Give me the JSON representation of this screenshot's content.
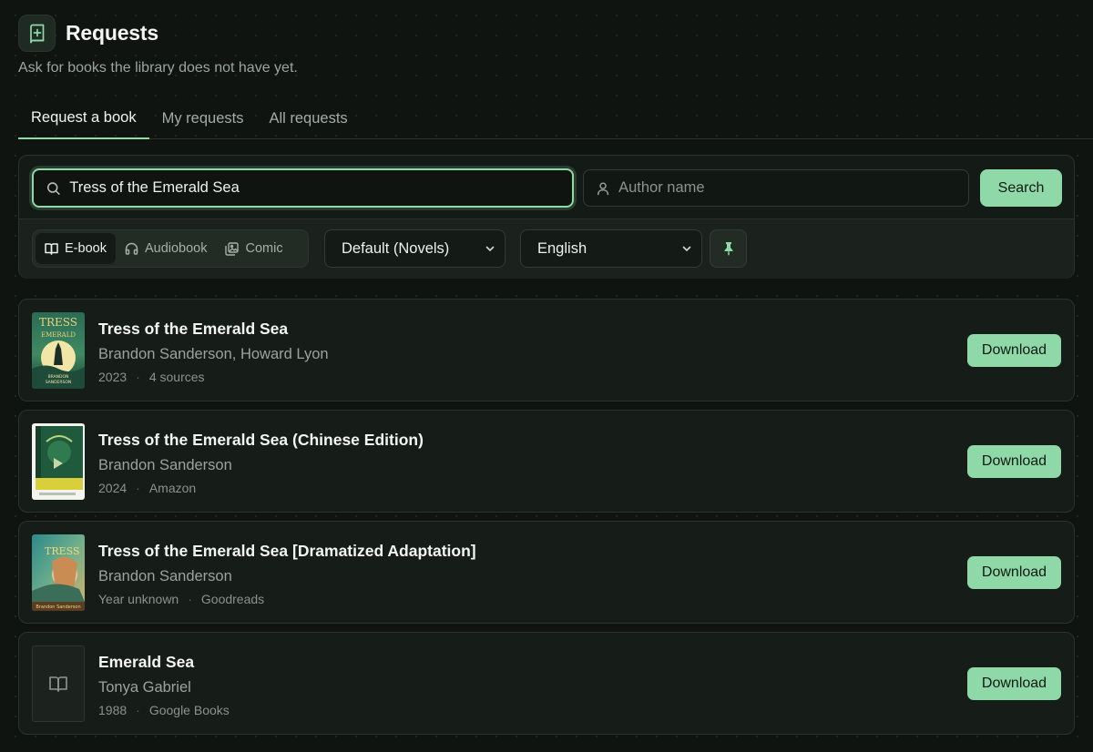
{
  "header": {
    "title": "Requests",
    "subtitle": "Ask for books the library does not have yet."
  },
  "tabs": [
    {
      "label": "Request a book",
      "active": true
    },
    {
      "label": "My requests",
      "active": false
    },
    {
      "label": "All requests",
      "active": false
    }
  ],
  "search": {
    "title_value": "Tress of the Emerald Sea",
    "author_placeholder": "Author name",
    "button_label": "Search"
  },
  "filters": {
    "types": [
      {
        "label": "E-book",
        "icon": "book-open-icon",
        "active": true
      },
      {
        "label": "Audiobook",
        "icon": "headphones-icon",
        "active": false
      },
      {
        "label": "Comic",
        "icon": "gallery-icon",
        "active": false
      }
    ],
    "category_selected": "Default (Novels)",
    "language_selected": "English"
  },
  "results": [
    {
      "title": "Tress of the Emerald Sea",
      "author": "Brandon Sanderson, Howard Lyon",
      "year": "2023",
      "source": "4 sources",
      "download_label": "Download",
      "cover": "Tress of the Emerald Sea cover"
    },
    {
      "title": "Tress of the Emerald Sea (Chinese Edition)",
      "author": "Brandon Sanderson",
      "year": "2024",
      "source": "Amazon",
      "download_label": "Download",
      "cover": "Chinese edition cover"
    },
    {
      "title": "Tress of the Emerald Sea [Dramatized Adaptation]",
      "author": "Brandon Sanderson",
      "year": "Year unknown",
      "source": "Goodreads",
      "download_label": "Download",
      "cover": "Dramatized adaptation cover"
    },
    {
      "title": "Emerald Sea",
      "author": "Tonya Gabriel",
      "year": "1988",
      "source": "Google Books",
      "download_label": "Download",
      "cover": "book-placeholder-icon"
    }
  ],
  "colors": {
    "accent": "#8fd9a8",
    "background": "#0f1410",
    "card": "#161c18"
  }
}
